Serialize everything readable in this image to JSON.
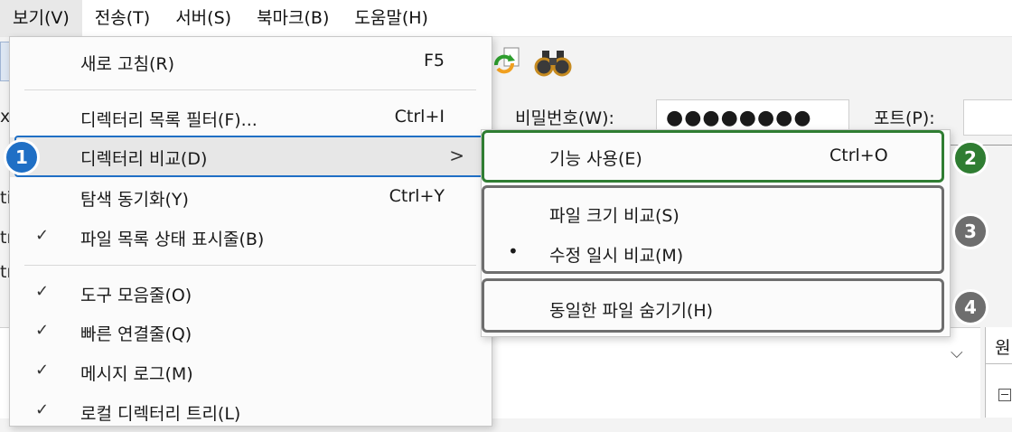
{
  "menubar": {
    "items": [
      "보기(V)",
      "전송(T)",
      "서버(S)",
      "북마크(B)",
      "도움말(H)"
    ]
  },
  "connection": {
    "password_label": "비밀번호(W):",
    "password_value": "●●●●●●●●",
    "port_label": "포트(P):"
  },
  "left_fragments": [
    "x",
    "ti",
    "tr",
    "tr",
    "tr"
  ],
  "right_pane": {
    "header_fragment": "원"
  },
  "view_menu": {
    "items": [
      {
        "label": "새로 고침(R)",
        "shortcut": "F5"
      },
      {
        "label": "디렉터리 목록 필터(F)...",
        "shortcut": "Ctrl+I"
      },
      {
        "label": "디렉터리 비교(D)",
        "submenu_arrow": ">"
      },
      {
        "label": "탐색 동기화(Y)",
        "shortcut": "Ctrl+Y"
      },
      {
        "label": "파일 목록 상태 표시줄(B)",
        "check": "✓"
      },
      {
        "label": "도구 모음줄(O)",
        "check": "✓"
      },
      {
        "label": "빠른 연결줄(Q)",
        "check": "✓"
      },
      {
        "label": "메시지 로그(M)",
        "check": "✓"
      },
      {
        "label": "로컬 디렉터리 트리(L)",
        "check": "✓"
      }
    ]
  },
  "compare_submenu": {
    "items": [
      {
        "label": "기능 사용(E)",
        "shortcut": "Ctrl+O"
      },
      {
        "label": "파일 크기 비교(S)"
      },
      {
        "label": "수정 일시 비교(M)",
        "bullet": "•"
      },
      {
        "label": "동일한 파일 숨기기(H)"
      }
    ]
  },
  "callouts": [
    "1",
    "2",
    "3",
    "4"
  ],
  "colors": {
    "blue": "#1f6fc5",
    "green": "#2f7d32",
    "gray": "#6e6e6e"
  }
}
